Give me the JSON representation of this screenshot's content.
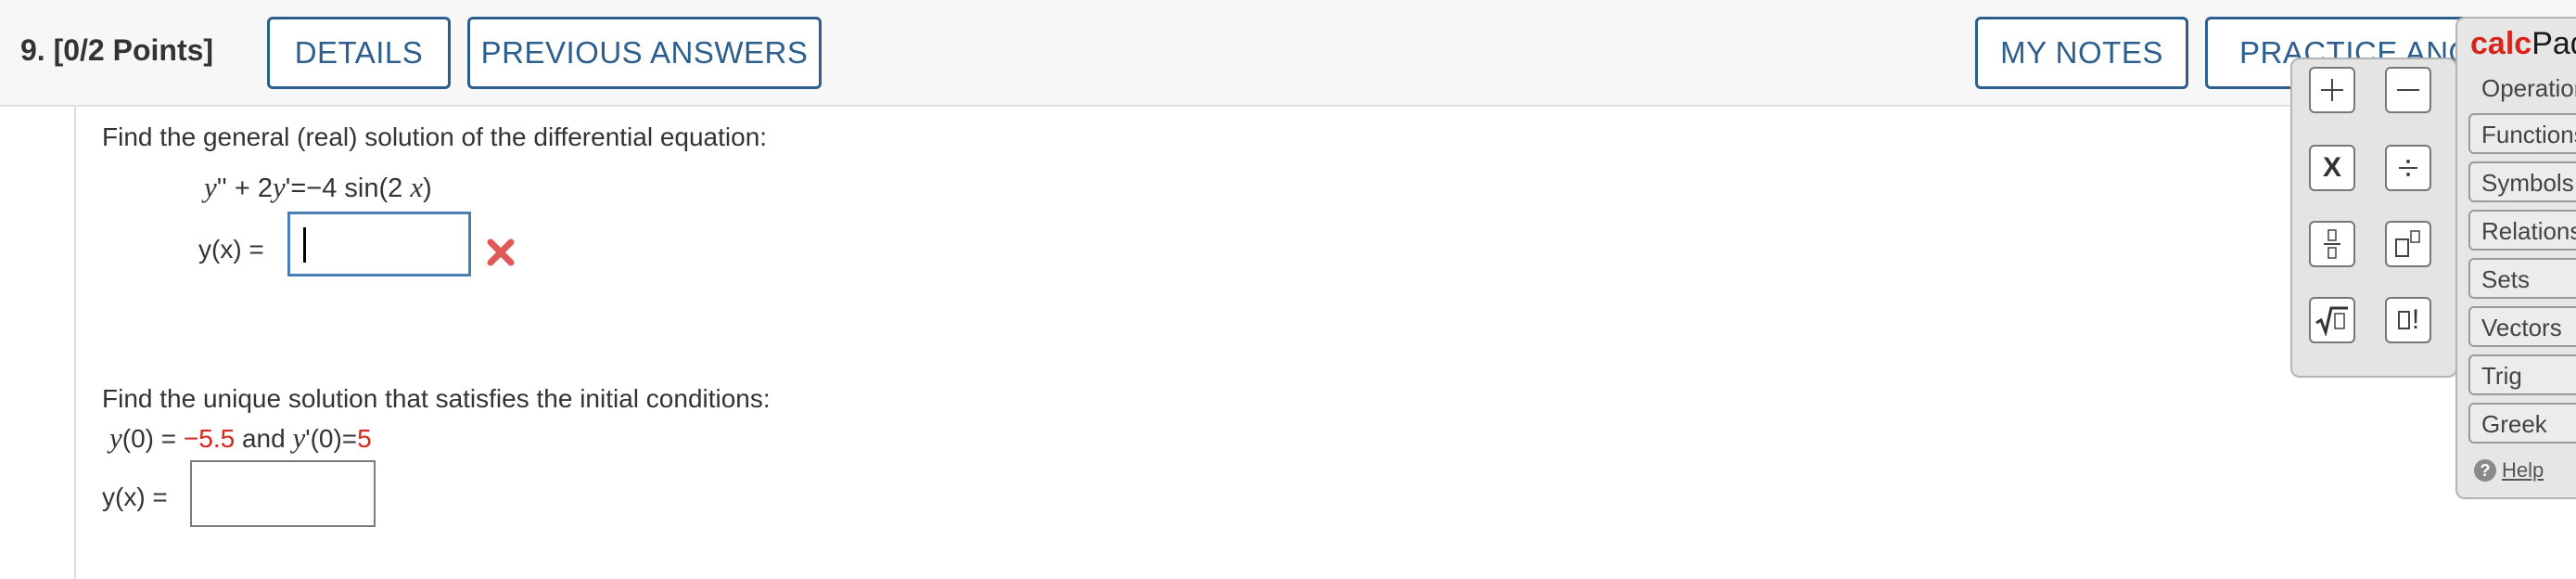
{
  "header": {
    "question_number": "9.",
    "points": "[0/2 Points]",
    "details_label": "DETAILS",
    "previous_answers_label": "PREVIOUS ANSWERS",
    "my_notes_label": "MY NOTES",
    "practice_label": "PRACTICE ANOTHER"
  },
  "part1": {
    "prompt": "Find the general (real) solution of the differential equation:",
    "equation": "y'' + 2y'=−4 sin(2 x)",
    "answer_label": "y(x) =",
    "answer_value": "",
    "status_icon": "incorrect-x-icon",
    "status_color": "#e05a5a"
  },
  "part2": {
    "prompt": "Find the unique solution that satisfies the initial conditions:",
    "condition_y0_label": "y(0) =",
    "condition_y0_value": "−5.5",
    "condition_and": "and",
    "condition_dy0_label": "y'(0)=",
    "condition_dy0_value": "5",
    "answer_label": "y(x) =",
    "answer_value": ""
  },
  "keypad": {
    "keys": [
      "+",
      "−",
      "X",
      "÷",
      "fraction",
      "exponent",
      "sqrt",
      "factorial"
    ],
    "times_label": "X",
    "factorial_label": "!"
  },
  "calcpad": {
    "title_part1": "calc",
    "title_part2": "Pad",
    "tabs": [
      "Operations",
      "Functions",
      "Symbols",
      "Relations",
      "Sets",
      "Vectors",
      "Trig",
      "Greek"
    ],
    "help_label": "Help"
  },
  "colors": {
    "accent": "#2d5f8e",
    "value_red": "#d9261c",
    "focus_border": "#4a7fb6"
  }
}
